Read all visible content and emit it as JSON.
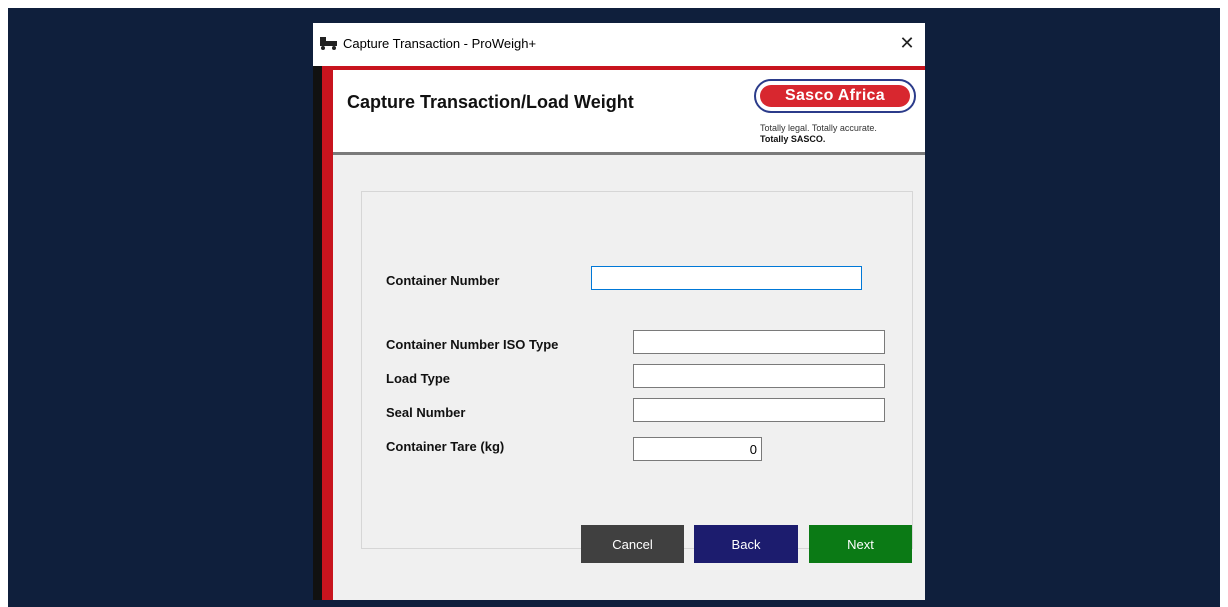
{
  "window": {
    "title": "Capture Transaction - ProWeigh+",
    "close_glyph": "✕",
    "app_icon": "truck-icon"
  },
  "header": {
    "heading": "Capture Transaction/Load Weight",
    "logo": {
      "brand": "Sasco Africa",
      "tagline_1": "Totally legal. Totally accurate.",
      "tagline_2": "Totally SASCO."
    }
  },
  "form": {
    "container_number": {
      "label": "Container Number",
      "value": ""
    },
    "iso_type": {
      "label": "Container Number ISO Type",
      "value": ""
    },
    "load_type": {
      "label": "Load Type",
      "value": ""
    },
    "seal_number": {
      "label": "Seal Number",
      "value": ""
    },
    "container_tare": {
      "label": "Container Tare (kg)",
      "value": "0"
    }
  },
  "buttons": {
    "cancel": "Cancel",
    "back": "Back",
    "next": "Next"
  },
  "colors": {
    "backdrop": "#0f1f3c",
    "accent_red": "#c8141e",
    "cancel": "#404040",
    "back": "#1c1c6e",
    "next": "#0b7a15"
  }
}
